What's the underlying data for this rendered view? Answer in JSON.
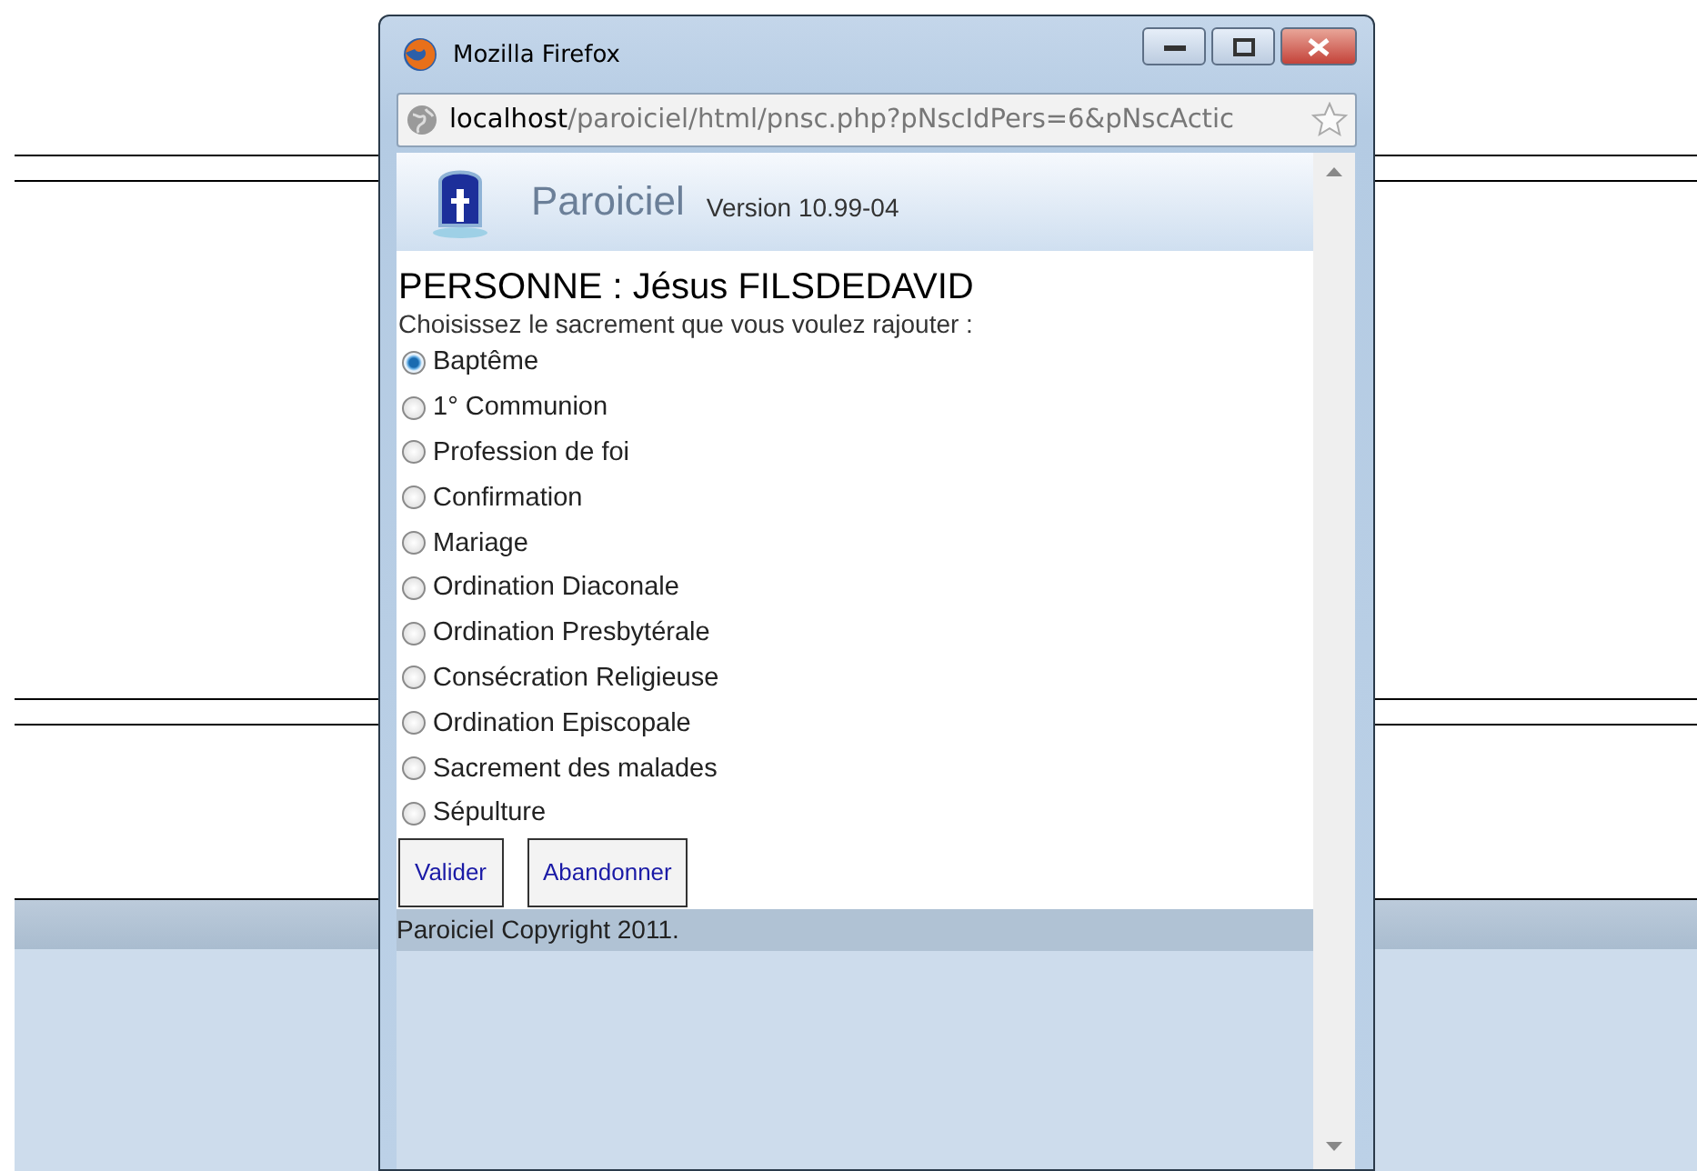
{
  "window": {
    "title": "Mozilla Firefox"
  },
  "address_bar": {
    "host": "localhost",
    "path": "/paroiciel/html/pnsc.php?pNscIdPers=6&pNscActic"
  },
  "header": {
    "app_name": "Paroiciel",
    "version": "Version 10.99-04"
  },
  "heading": "PERSONNE : Jésus FILSDEDAVID",
  "prompt": "Choisissez le sacrement que vous voulez rajouter :",
  "options": [
    {
      "label": "Baptême",
      "selected": true
    },
    {
      "label": "1° Communion",
      "selected": false
    },
    {
      "label": "Profession de foi",
      "selected": false
    },
    {
      "label": "Confirmation",
      "selected": false
    },
    {
      "label": "Mariage",
      "selected": false
    },
    {
      "label": "Ordination Diaconale",
      "selected": false
    },
    {
      "label": "Ordination Presbytérale",
      "selected": false
    },
    {
      "label": "Consécration Religieuse",
      "selected": false
    },
    {
      "label": "Ordination Episcopale",
      "selected": false
    },
    {
      "label": "Sacrement des malades",
      "selected": false
    },
    {
      "label": "Sépulture",
      "selected": false
    }
  ],
  "buttons": [
    "Valider",
    "Abandonner"
  ],
  "footer": "Paroiciel Copyright 2011."
}
